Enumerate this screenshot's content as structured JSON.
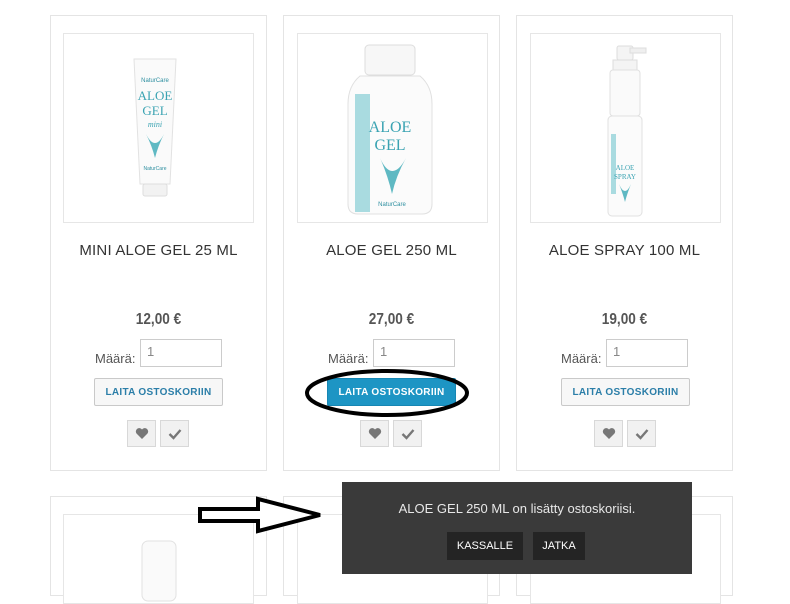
{
  "products": [
    {
      "name": "MINI ALOE GEL 25 ML",
      "price": "12,00 €",
      "qty_label": "Määrä:",
      "qty_value": "1",
      "add_label": "LAITA OSTOSKORIIN"
    },
    {
      "name": "ALOE GEL 250 ML",
      "price": "27,00 €",
      "qty_label": "Määrä:",
      "qty_value": "1",
      "add_label": "LAITA OSTOSKORIIN"
    },
    {
      "name": "ALOE SPRAY 100 ML",
      "price": "19,00 €",
      "qty_label": "Määrä:",
      "qty_value": "1",
      "add_label": "LAITA OSTOSKORIIN"
    }
  ],
  "product_images": [
    {
      "brand": "NaturCare",
      "line1": "ALOE",
      "line2": "GEL",
      "line3": "mini"
    },
    {
      "brand": "NaturCare",
      "line1": "ALOE",
      "line2": "GEL"
    },
    {
      "line1": "ALOE",
      "line2": "SPRAY"
    }
  ],
  "popup": {
    "message": "ALOE GEL 250 ML on lisätty ostoskoriisi.",
    "checkout_label": "KASSALLE",
    "continue_label": "JATKA"
  },
  "colors": {
    "accent": "#1d95c4",
    "popup_bg": "#3a3a3a",
    "link_blue": "#2b7ea8"
  },
  "icons": [
    "heart-icon",
    "check-icon",
    "arrow-icon"
  ]
}
